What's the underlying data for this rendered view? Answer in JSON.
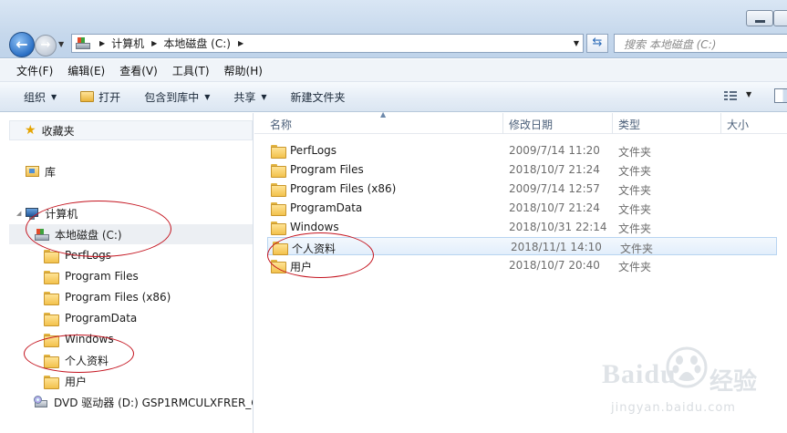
{
  "address": {
    "crumbs": [
      "计算机",
      "本地磁盘 (C:)"
    ]
  },
  "search": {
    "placeholder": "搜索 本地磁盘 (C:)"
  },
  "menu": [
    "文件(F)",
    "编辑(E)",
    "查看(V)",
    "工具(T)",
    "帮助(H)"
  ],
  "commands": {
    "organize": "组织",
    "open": "打开",
    "include_in_library": "包含到库中",
    "share": "共享",
    "new_folder": "新建文件夹"
  },
  "nav": {
    "favorites": "收藏夹",
    "libraries": "库",
    "computer": "计算机",
    "local_disk": "本地磁盘 (C:)",
    "folders": [
      "PerfLogs",
      "Program Files",
      "Program Files (x86)",
      "ProgramData",
      "Windows",
      "个人资料",
      "用户"
    ],
    "dvd": "DVD 驱动器 (D:) GSP1RMCULXFRER_C"
  },
  "columns": {
    "name": "名称",
    "date": "修改日期",
    "type": "类型",
    "size": "大小"
  },
  "files": [
    {
      "name": "PerfLogs",
      "date": "2009/7/14 11:20",
      "type": "文件夹"
    },
    {
      "name": "Program Files",
      "date": "2018/10/7 21:24",
      "type": "文件夹"
    },
    {
      "name": "Program Files (x86)",
      "date": "2009/7/14 12:57",
      "type": "文件夹"
    },
    {
      "name": "ProgramData",
      "date": "2018/10/7 21:24",
      "type": "文件夹"
    },
    {
      "name": "Windows",
      "date": "2018/10/31 22:14",
      "type": "文件夹"
    },
    {
      "name": "个人资料",
      "date": "2018/11/1 14:10",
      "type": "文件夹",
      "selected": true
    },
    {
      "name": "用户",
      "date": "2018/10/7 20:40",
      "type": "文件夹"
    }
  ],
  "watermark": {
    "brand": "Baidu",
    "cn": "经验",
    "url": "jingyan.baidu.com"
  },
  "colors": {
    "annotation": "#c4141f",
    "selection": "#e2eefb",
    "accent": "#2a6fc4"
  }
}
